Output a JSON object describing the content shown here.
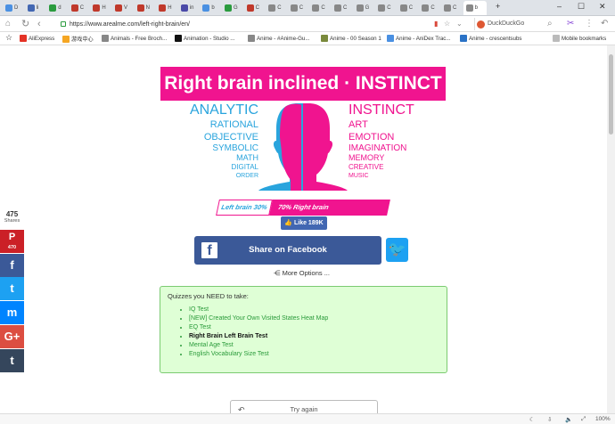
{
  "browser": {
    "tabs": [
      {
        "label": "D",
        "color": "#4a90e2"
      },
      {
        "label": "li",
        "color": "#4267b2"
      },
      {
        "label": "d",
        "color": "#2a9b3e"
      },
      {
        "label": "C",
        "color": "#c0392b"
      },
      {
        "label": "H",
        "color": "#c0392b"
      },
      {
        "label": "V",
        "color": "#c0392b"
      },
      {
        "label": "N",
        "color": "#c0392b"
      },
      {
        "label": "H",
        "color": "#c0392b"
      },
      {
        "label": "in",
        "color": "#4a4aa8"
      },
      {
        "label": "b",
        "color": "#4a90e2"
      },
      {
        "label": "G",
        "color": "#2a9b3e"
      },
      {
        "label": "C",
        "color": "#c0392b"
      },
      {
        "label": "C",
        "color": "#888888"
      },
      {
        "label": "C",
        "color": "#888888"
      },
      {
        "label": "C",
        "color": "#888888"
      },
      {
        "label": "C",
        "color": "#888888"
      },
      {
        "label": "G",
        "color": "#888888"
      },
      {
        "label": "C",
        "color": "#888888"
      },
      {
        "label": "C",
        "color": "#888888"
      },
      {
        "label": "C",
        "color": "#888888"
      },
      {
        "label": "C",
        "color": "#888888"
      },
      {
        "label": "b",
        "color": "#888888"
      }
    ],
    "new_tab": "+",
    "url": "https://www.arealme.com/left-right-brain/en/",
    "search_engine": "DuckDuckGo",
    "zoom": "100%",
    "bookmarks": [
      {
        "label": "AliExpress",
        "color": "#e43225"
      },
      {
        "label": "游戏中心",
        "color": "#f5a623"
      },
      {
        "label": "Animals - Free Broch...",
        "color": "#888888"
      },
      {
        "label": "Animation - Studio ...",
        "color": "#111111"
      },
      {
        "label": "Anime - #Anime-Gu...",
        "color": "#888888"
      },
      {
        "label": "Anime - 00 Season 1",
        "color": "#7a8a3c"
      },
      {
        "label": "Anime - AniDex Trac...",
        "color": "#4a90e2"
      },
      {
        "label": "Anime - crescentsubs",
        "color": "#2a72c6"
      }
    ],
    "mobile_bookmarks": "Mobile bookmarks"
  },
  "share_sidebar": {
    "count": "475",
    "count_label": "Shares",
    "pinterest_count": "470",
    "buttons": [
      {
        "name": "pinterest",
        "glyph": "P",
        "color": "#cb2027"
      },
      {
        "name": "facebook",
        "glyph": "f",
        "color": "#3b5998"
      },
      {
        "name": "twitter",
        "glyph": "t",
        "color": "#1da1f2"
      },
      {
        "name": "messenger",
        "glyph": "m",
        "color": "#0084ff"
      },
      {
        "name": "google-plus",
        "glyph": "G+",
        "color": "#dc4e41"
      },
      {
        "name": "tumblr",
        "glyph": "t",
        "color": "#35465c"
      }
    ]
  },
  "result": {
    "title": "Right brain inclined · INSTINCT",
    "left_traits": [
      "ANALYTIC",
      "RATIONAL",
      "OBJECTIVE",
      "SYMBOLIC",
      "MATH",
      "DIGITAL",
      "ORDER"
    ],
    "right_traits": [
      "INSTINCT",
      "ART",
      "EMOTION",
      "IMAGINATION",
      "MEMORY",
      "CREATIVE",
      "MUSIC"
    ],
    "left_label": "Left brain 30%",
    "right_label": "70% Right brain",
    "left_percent": 30,
    "right_percent": 70,
    "left_color": "#29a4dd",
    "right_color": "#f0148f"
  },
  "actions": {
    "like_label": "Like 189K",
    "share_facebook_label": "Share on Facebook",
    "more_options_label": "More Options ..."
  },
  "quizzes": {
    "title": "Quizzes you NEED to take:",
    "items": [
      {
        "label": "IQ Test",
        "bold": false
      },
      {
        "label": "[NEW] Created Your Own Visited States Heat Map",
        "bold": false
      },
      {
        "label": "EQ Test",
        "bold": false
      },
      {
        "label": "Right Brain Left Brain Test",
        "bold": true
      },
      {
        "label": "Mental Age Test",
        "bold": false
      },
      {
        "label": "English Vocabulary Size Test",
        "bold": false
      }
    ]
  },
  "try_again_label": "Try again"
}
